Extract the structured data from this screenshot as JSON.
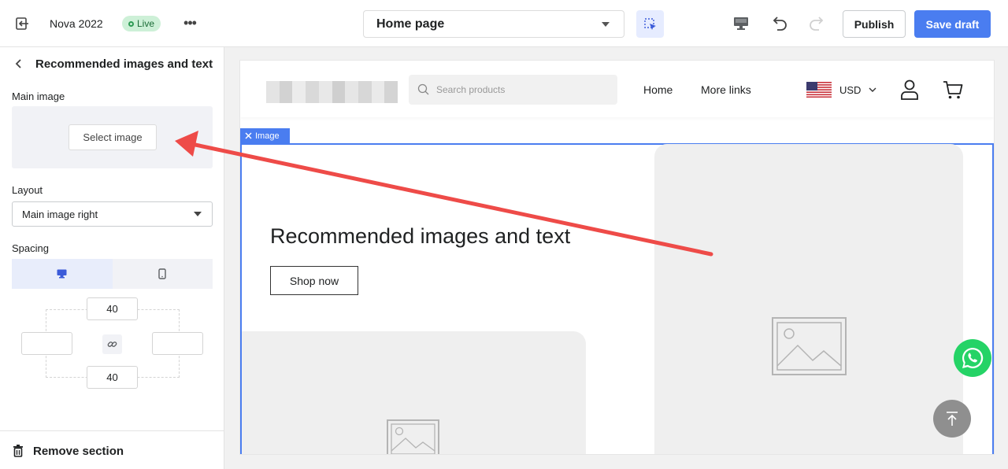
{
  "topbar": {
    "store_name": "Nova 2022",
    "live_label": "Live",
    "more_glyph": "•••",
    "page_select_value": "Home page",
    "publish_label": "Publish",
    "save_draft_label": "Save draft",
    "accent_color": "#4a7df0"
  },
  "sidebar": {
    "title": "Recommended images and text",
    "main_image_label": "Main image",
    "select_image_label": "Select image",
    "layout_label": "Layout",
    "layout_value": "Main image right",
    "spacing_label": "Spacing",
    "spacing_top": "40",
    "spacing_bottom": "40",
    "spacing_left": "",
    "spacing_right": "",
    "remove_section_label": "Remove section"
  },
  "preview": {
    "search_placeholder": "Search products",
    "nav_links": [
      "Home",
      "More links"
    ],
    "currency_code": "USD",
    "section_tag_label": "Image",
    "hero_title": "Recommended images and text",
    "shop_button_label": "Shop now"
  },
  "icons": {
    "exit": "exit-icon",
    "inspect": "select-element-icon",
    "desktop": "desktop-icon",
    "undo": "undo-icon",
    "redo": "redo-icon",
    "back": "chevron-left-icon",
    "mobile": "mobile-icon",
    "link": "link-icon",
    "trash": "trash-icon",
    "search": "search-icon",
    "flag": "us-flag-icon",
    "account": "account-icon",
    "cart": "cart-icon",
    "whatsapp": "whatsapp-icon",
    "back_to_top": "arrow-up-icon",
    "image_placeholder": "image-placeholder-icon"
  },
  "annotation_color": "#ee4b48"
}
